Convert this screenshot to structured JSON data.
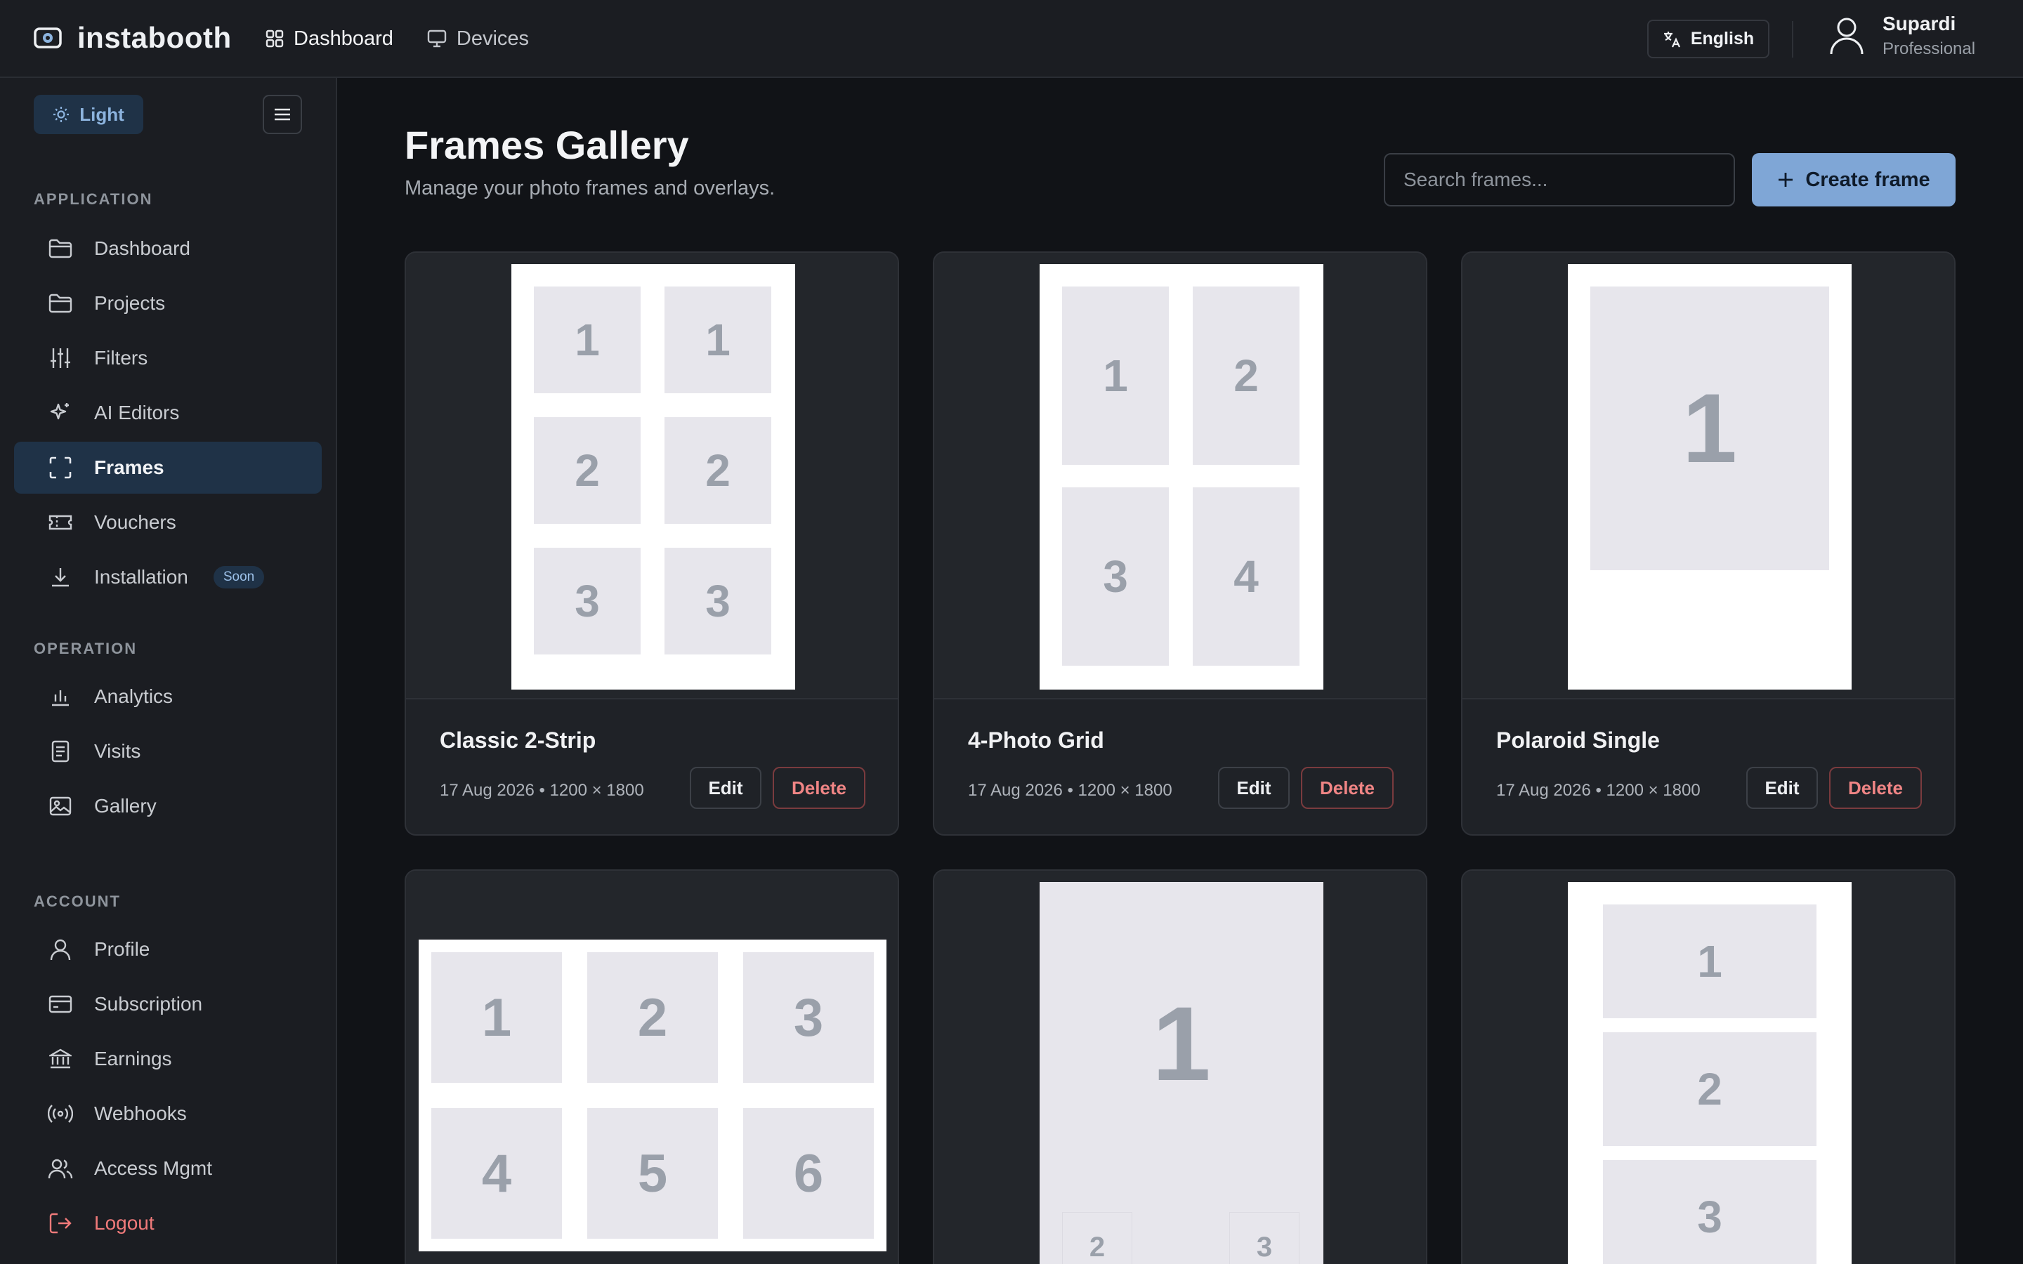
{
  "brand": {
    "name": "instabooth"
  },
  "topnav": [
    {
      "label": "Dashboard",
      "icon": "grid-icon",
      "active": true
    },
    {
      "label": "Devices",
      "icon": "monitor-icon",
      "active": false
    }
  ],
  "language": {
    "label": "English",
    "icon": "translate-icon"
  },
  "user": {
    "name": "Supardi",
    "plan": "Professional"
  },
  "sidebar": {
    "theme_label": "Light",
    "sections": [
      {
        "label": "APPLICATION"
      },
      {
        "label": "OPERATION"
      },
      {
        "label": "ACCOUNT"
      }
    ],
    "items": [
      {
        "label": "Dashboard",
        "icon": "folder-icon"
      },
      {
        "label": "Projects",
        "icon": "folder-icon"
      },
      {
        "label": "Filters",
        "icon": "sliders-icon"
      },
      {
        "label": "AI Editors",
        "icon": "sparkle-icon"
      },
      {
        "label": "Frames",
        "icon": "frame-icon",
        "active": true
      },
      {
        "label": "Vouchers",
        "icon": "ticket-icon"
      },
      {
        "label": "Installation",
        "icon": "download-icon",
        "badge": "Soon"
      },
      {
        "label": "Analytics",
        "icon": "bar-chart-icon"
      },
      {
        "label": "Visits",
        "icon": "document-icon"
      },
      {
        "label": "Gallery",
        "icon": "image-icon"
      },
      {
        "label": "Profile",
        "icon": "user-icon"
      },
      {
        "label": "Subscription",
        "icon": "credit-card-icon"
      },
      {
        "label": "Earnings",
        "icon": "bank-icon"
      },
      {
        "label": "Webhooks",
        "icon": "broadcast-icon"
      },
      {
        "label": "Access Mgmt",
        "icon": "users-icon"
      },
      {
        "label": "Logout",
        "icon": "logout-icon"
      }
    ]
  },
  "main": {
    "title": "Frames Gallery",
    "subtitle": "Manage your photo frames and overlays.",
    "search_placeholder": "Search frames...",
    "create_label": "Create frame",
    "edit_label": "Edit",
    "delete_label": "Delete",
    "cards": [
      {
        "title": "Classic 2-Strip",
        "meta": "17 Aug 2026 • 1200 × 1800",
        "slots": [
          "1",
          "1",
          "2",
          "2",
          "3",
          "3"
        ]
      },
      {
        "title": "4-Photo Grid",
        "meta": "17 Aug 2026 • 1200 × 1800",
        "slots": [
          "1",
          "2",
          "3",
          "4"
        ]
      },
      {
        "title": "Polaroid Single",
        "meta": "17 Aug 2026 • 1200 × 1800",
        "slots": [
          "1"
        ]
      },
      {
        "title": "",
        "meta": "",
        "slots": [
          "1",
          "2",
          "3",
          "4",
          "5",
          "6"
        ]
      },
      {
        "title": "",
        "meta": "",
        "slots": [
          "1",
          "2",
          "3"
        ]
      },
      {
        "title": "",
        "meta": "",
        "slots": [
          "1",
          "2",
          "3"
        ]
      }
    ]
  },
  "colors": {
    "accent": "#7fa6d6",
    "active_bg": "#1f3247",
    "danger": "#f08585",
    "background": "#111317",
    "surface": "#1b1d22"
  }
}
